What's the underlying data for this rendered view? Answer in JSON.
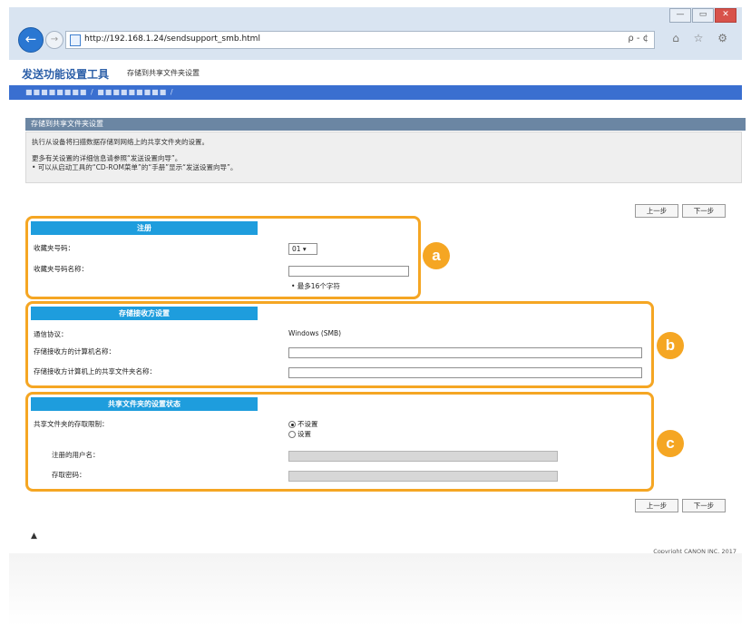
{
  "browser": {
    "url": "http://192.168.1.24/sendsupport_smb.html",
    "search_glyph": "ρ - ¢",
    "toolbar_icons": "⌂ ☆ ⚙",
    "win_min": "—",
    "win_max": "▭",
    "win_close": "✕"
  },
  "app": {
    "title": "发送功能设置工具",
    "subtitle": "存储到共享文件夹设置",
    "breadcrumb": "■■■■■■■■ / ■■■■■■■■■ /"
  },
  "page": {
    "header": "存储到共享文件夹设置",
    "intro_lines": [
      "执行从设备将扫描数据存储到网络上的共享文件夹的设置。",
      "更多有关设置的详细信息请参照“发送设置向导”。",
      "• 可以从启动工具的“CD-ROM菜单”的“手册”显示“发送设置向导”。"
    ],
    "prev_label": "上一步",
    "next_label": "下一步"
  },
  "group_a": {
    "marker": "a",
    "title": "注册",
    "fields": [
      {
        "label": "收藏夹号码：",
        "value": "01"
      },
      {
        "label": "收藏夹号码名称：",
        "value": ""
      }
    ],
    "hint": "• 最多16个字符"
  },
  "group_b": {
    "marker": "b",
    "title": "存储接收方设置",
    "fields": [
      {
        "label": "通信协议：",
        "value": "Windows (SMB)"
      },
      {
        "label": "存储接收方的计算机名称：",
        "value": ""
      },
      {
        "label": "存储接收方计算机上的共享文件夹名称：",
        "value": ""
      }
    ]
  },
  "group_c": {
    "marker": "c",
    "title": "共享文件夹的设置状态",
    "access_label": "共享文件夹的存取限制：",
    "options": [
      "不设置",
      "设置"
    ],
    "selected": "不设置",
    "fields": [
      {
        "label": "注册的用户名：",
        "value": ""
      },
      {
        "label": "存取密码：",
        "value": ""
      }
    ]
  },
  "footer": {
    "top_link": "▲",
    "copyright": "Copyright CANON INC. 2017"
  },
  "colors": {
    "accent_orange": "#f5a623",
    "section_blue": "#1e9ddd",
    "nav_blue": "#3a6fd0"
  }
}
